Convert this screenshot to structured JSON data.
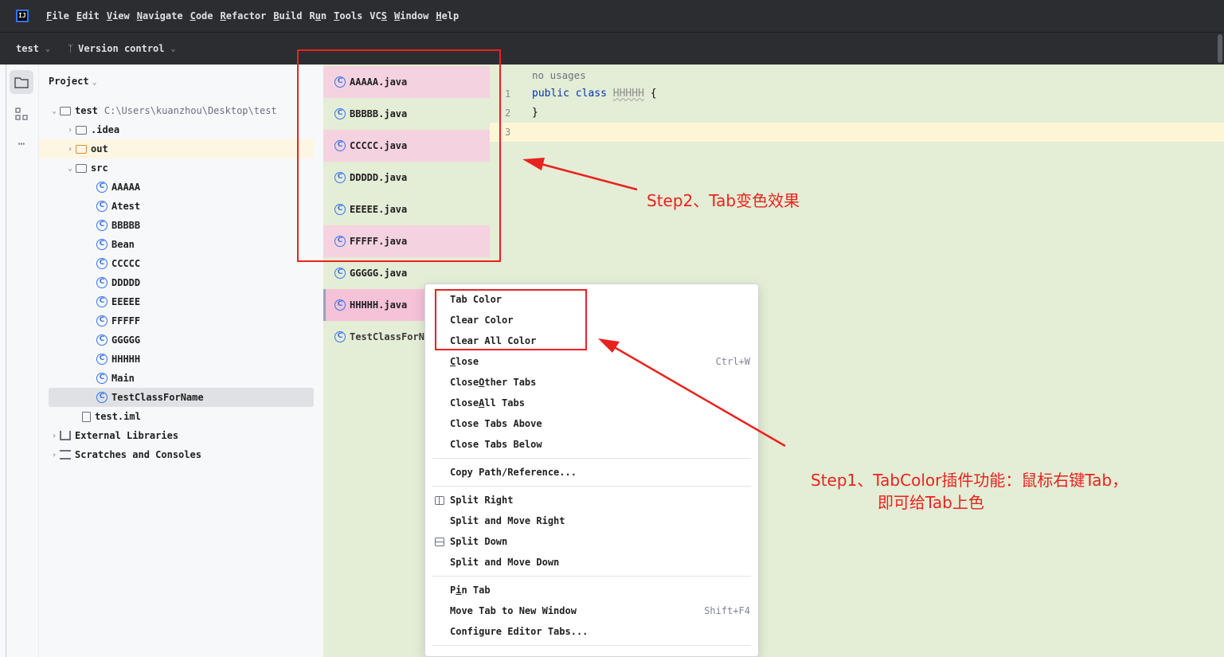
{
  "menubar": {
    "logo": "IJ",
    "items": [
      {
        "pre": "",
        "mn": "F",
        "post": "ile"
      },
      {
        "pre": "",
        "mn": "E",
        "post": "dit"
      },
      {
        "pre": "",
        "mn": "V",
        "post": "iew"
      },
      {
        "pre": "",
        "mn": "N",
        "post": "avigate"
      },
      {
        "pre": "",
        "mn": "C",
        "post": "ode"
      },
      {
        "pre": "",
        "mn": "R",
        "post": "efactor"
      },
      {
        "pre": "",
        "mn": "B",
        "post": "uild"
      },
      {
        "pre": "R",
        "mn": "u",
        "post": "n"
      },
      {
        "pre": "",
        "mn": "T",
        "post": "ools"
      },
      {
        "pre": "VC",
        "mn": "S",
        "post": ""
      },
      {
        "pre": "",
        "mn": "W",
        "post": "indow"
      },
      {
        "pre": "",
        "mn": "H",
        "post": "elp"
      }
    ]
  },
  "toolbar": {
    "project_name": "test",
    "vcs_label": "Version control"
  },
  "project_panel": {
    "title": "Project",
    "root_name": "test",
    "root_path": "C:\\Users\\kuanzhou\\Desktop\\test",
    "idea": ".idea",
    "out": "out",
    "src": "src",
    "classes": [
      "AAAAA",
      "Atest",
      "BBBBB",
      "Bean",
      "CCCCC",
      "DDDDD",
      "EEEEE",
      "FFFFF",
      "GGGGG",
      "HHHHH",
      "Main",
      "TestClassForName"
    ],
    "iml": "test.iml",
    "external_libraries": "External Libraries",
    "scratches": "Scratches and Consoles"
  },
  "editor": {
    "tabs": [
      "AAAAA.java",
      "BBBBB.java",
      "CCCCC.java",
      "DDDDD.java",
      "EEEEE.java",
      "FFFFF.java",
      "GGGGG.java",
      "HHHHH.java",
      "TestClassForN"
    ],
    "usages_hint": "no usages",
    "line_numbers": [
      "1",
      "2",
      "3"
    ],
    "code": {
      "kw_public": "public",
      "kw_class": "class",
      "class_name": "HHHHH",
      "open_brace": "{",
      "close_brace": "}"
    }
  },
  "context_menu": {
    "tab_color": "Tab Color",
    "clear_color": "Clear Color",
    "clear_all_color": "Clear All Color",
    "close": {
      "pre": "",
      "mn": "C",
      "post": "lose",
      "shortcut": "Ctrl+W"
    },
    "close_other": {
      "pre": "Close ",
      "mn": "O",
      "post": "ther Tabs"
    },
    "close_all": {
      "pre": "Close ",
      "mn": "A",
      "post": "ll Tabs"
    },
    "close_above": "Close Tabs Above",
    "close_below": "Close Tabs Below",
    "copy_path": "Copy Path/Reference...",
    "split_right": "Split Right",
    "split_move_right": "Split and Move Right",
    "split_down": "Split Down",
    "split_move_down": "Split and Move Down",
    "pin_tab": {
      "pre": "P",
      "mn": "i",
      "post": "n Tab"
    },
    "move_tab": "Move Tab to New Window",
    "move_tab_shortcut": "Shift+F4",
    "configure": "Configure Editor Tabs..."
  },
  "annotations": {
    "step2": "Step2、Tab变色效果",
    "step1_line1": "Step1、TabColor插件功能：鼠标右键Tab，",
    "step1_line2": "即可给Tab上色",
    "color": "#e8231f"
  },
  "colors": {
    "editor_bg": "#e4edd5",
    "tab_pink": "#f5d2df",
    "menubar_bg": "#2b2d30"
  }
}
